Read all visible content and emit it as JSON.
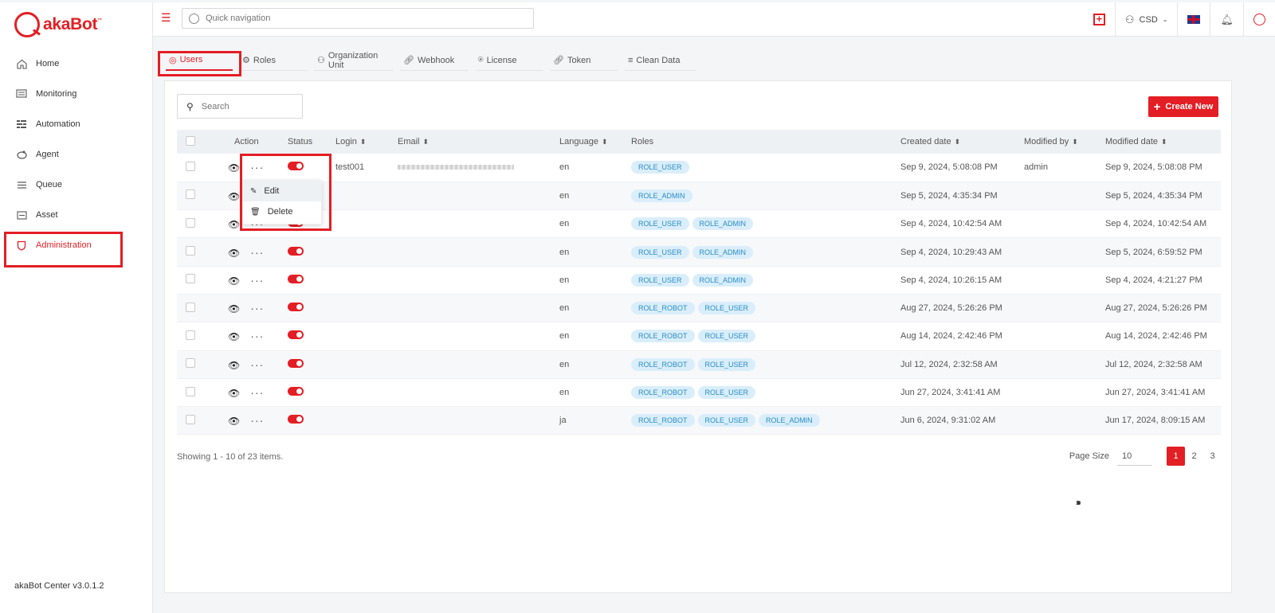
{
  "brand": {
    "name_prefix": "aka",
    "name_suffix": "Bot",
    "tm": "™"
  },
  "sidebar": {
    "items": [
      {
        "label": "Home",
        "icon": "home-icon"
      },
      {
        "label": "Monitoring",
        "icon": "monitor-icon"
      },
      {
        "label": "Automation",
        "icon": "automation-icon"
      },
      {
        "label": "Agent",
        "icon": "agent-icon"
      },
      {
        "label": "Queue",
        "icon": "queue-icon"
      },
      {
        "label": "Asset",
        "icon": "asset-icon"
      },
      {
        "label": "Administration",
        "icon": "shield-icon",
        "active": true
      }
    ],
    "version": "akaBot Center v3.0.1.2"
  },
  "topbar": {
    "quick_nav_placeholder": "Quick navigation",
    "tenant": "CSD"
  },
  "tabs": [
    {
      "label": "Users",
      "icon": "user-circle-icon",
      "active": true
    },
    {
      "label": "Roles",
      "icon": "roles-icon"
    },
    {
      "label": "Organization Unit",
      "icon": "org-icon"
    },
    {
      "label": "Webhook",
      "icon": "link-icon"
    },
    {
      "label": "License",
      "icon": "license-icon"
    },
    {
      "label": "Token",
      "icon": "link-icon"
    },
    {
      "label": "Clean Data",
      "icon": "clean-icon"
    }
  ],
  "toolbar": {
    "search_placeholder": "Search",
    "create_label": "Create New"
  },
  "table": {
    "headers": {
      "action": "Action",
      "status": "Status",
      "login": "Login",
      "email": "Email",
      "language": "Language",
      "roles": "Roles",
      "created": "Created date",
      "modified_by": "Modified by",
      "modified": "Modified date"
    },
    "rows": [
      {
        "login": "test001",
        "email": "",
        "language": "en",
        "roles": [
          "ROLE_USER"
        ],
        "created": "Sep 9, 2024, 5:08:08 PM",
        "modified_by": "admin",
        "modified": "Sep 9, 2024, 5:08:08 PM"
      },
      {
        "login": "",
        "email": "",
        "language": "en",
        "roles": [
          "ROLE_ADMIN"
        ],
        "created": "Sep 5, 2024, 4:35:34 PM",
        "modified_by": "",
        "modified": "Sep 5, 2024, 4:35:34 PM"
      },
      {
        "login": "",
        "email": "",
        "language": "en",
        "roles": [
          "ROLE_USER",
          "ROLE_ADMIN"
        ],
        "created": "Sep 4, 2024, 10:42:54 AM",
        "modified_by": "",
        "modified": "Sep 4, 2024, 10:42:54 AM"
      },
      {
        "login": "",
        "email": "",
        "language": "en",
        "roles": [
          "ROLE_USER",
          "ROLE_ADMIN"
        ],
        "created": "Sep 4, 2024, 10:29:43 AM",
        "modified_by": "",
        "modified": "Sep 5, 2024, 6:59:52 PM"
      },
      {
        "login": "",
        "email": "",
        "language": "en",
        "roles": [
          "ROLE_USER",
          "ROLE_ADMIN"
        ],
        "created": "Sep 4, 2024, 10:26:15 AM",
        "modified_by": "",
        "modified": "Sep 4, 2024, 4:21:27 PM"
      },
      {
        "login": "",
        "email": "",
        "language": "en",
        "roles": [
          "ROLE_ROBOT",
          "ROLE_USER"
        ],
        "created": "Aug 27, 2024, 5:26:26 PM",
        "modified_by": "",
        "modified": "Aug 27, 2024, 5:26:26 PM"
      },
      {
        "login": "",
        "email": "",
        "language": "en",
        "roles": [
          "ROLE_ROBOT",
          "ROLE_USER"
        ],
        "created": "Aug 14, 2024, 2:42:46 PM",
        "modified_by": "",
        "modified": "Aug 14, 2024, 2:42:46 PM"
      },
      {
        "login": "",
        "email": "",
        "language": "en",
        "roles": [
          "ROLE_ROBOT",
          "ROLE_USER"
        ],
        "created": "Jul 12, 2024, 2:32:58 AM",
        "modified_by": "",
        "modified": "Jul 12, 2024, 2:32:58 AM"
      },
      {
        "login": "",
        "email": "",
        "language": "en",
        "roles": [
          "ROLE_ROBOT",
          "ROLE_USER"
        ],
        "created": "Jun 27, 2024, 3:41:41 AM",
        "modified_by": "",
        "modified": "Jun 27, 2024, 3:41:41 AM"
      },
      {
        "login": "",
        "email": "",
        "language": "ja",
        "roles": [
          "ROLE_ROBOT",
          "ROLE_USER",
          "ROLE_ADMIN"
        ],
        "created": "Jun 6, 2024, 9:31:02 AM",
        "modified_by": "",
        "modified": "Jun 17, 2024, 8:09:15 AM"
      }
    ]
  },
  "dropdown": {
    "edit": "Edit",
    "delete": "Delete"
  },
  "pagination": {
    "info": "Showing 1 - 10 of 23 items.",
    "page_size_label": "Page Size",
    "page_size": "10",
    "pages": [
      "1",
      "2",
      "3"
    ],
    "current": "1"
  },
  "colors": {
    "accent": "#e31e24",
    "role_bg": "#d9eefa",
    "role_text": "#2b8cc4"
  }
}
